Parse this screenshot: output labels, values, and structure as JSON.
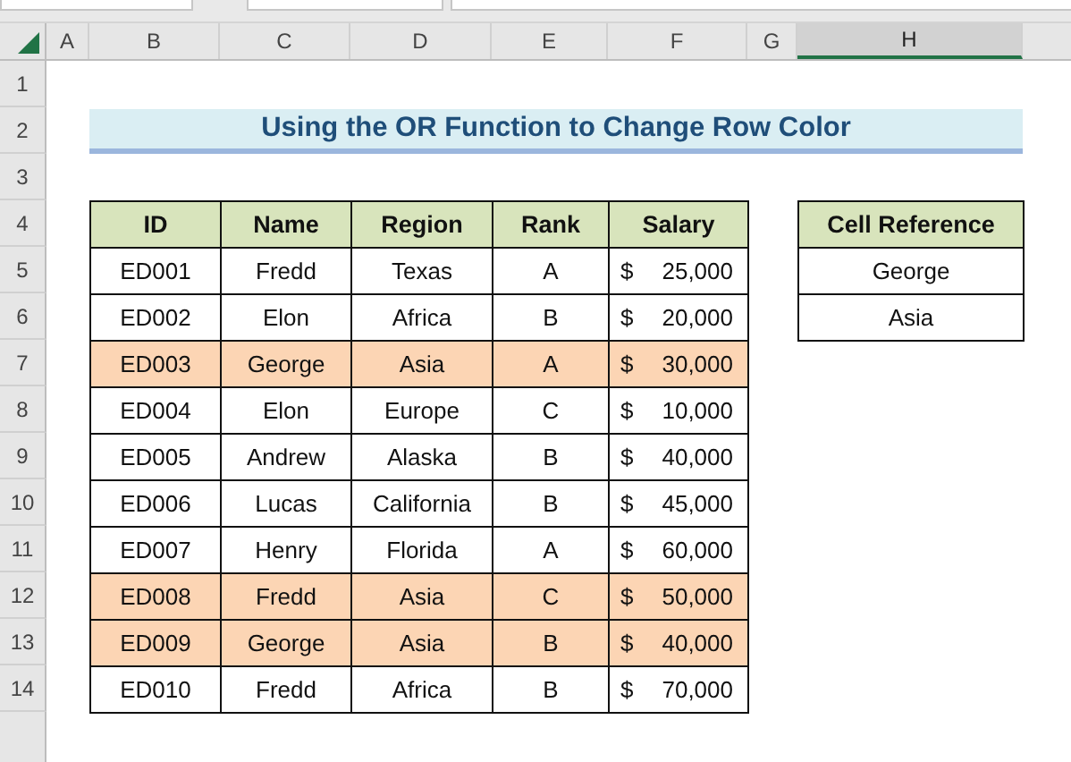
{
  "column_headers": [
    {
      "label": "A",
      "selected": false
    },
    {
      "label": "B",
      "selected": false
    },
    {
      "label": "C",
      "selected": false
    },
    {
      "label": "D",
      "selected": false
    },
    {
      "label": "E",
      "selected": false
    },
    {
      "label": "F",
      "selected": false
    },
    {
      "label": "G",
      "selected": false
    },
    {
      "label": "H",
      "selected": true
    }
  ],
  "row_headers": [
    "1",
    "2",
    "3",
    "4",
    "5",
    "6",
    "7",
    "8",
    "9",
    "10",
    "11",
    "12",
    "13",
    "14"
  ],
  "title": "Using the OR Function to Change Row Color",
  "table": {
    "columns": [
      "ID",
      "Name",
      "Region",
      "Rank",
      "Salary"
    ],
    "rows": [
      {
        "id": "ED001",
        "name": "Fredd",
        "region": "Texas",
        "rank": "A",
        "currency": "$",
        "salary": "25,000",
        "highlighted": false
      },
      {
        "id": "ED002",
        "name": "Elon",
        "region": "Africa",
        "rank": "B",
        "currency": "$",
        "salary": "20,000",
        "highlighted": false
      },
      {
        "id": "ED003",
        "name": "George",
        "region": "Asia",
        "rank": "A",
        "currency": "$",
        "salary": "30,000",
        "highlighted": true
      },
      {
        "id": "ED004",
        "name": "Elon",
        "region": "Europe",
        "rank": "C",
        "currency": "$",
        "salary": "10,000",
        "highlighted": false
      },
      {
        "id": "ED005",
        "name": "Andrew",
        "region": "Alaska",
        "rank": "B",
        "currency": "$",
        "salary": "40,000",
        "highlighted": false
      },
      {
        "id": "ED006",
        "name": "Lucas",
        "region": "California",
        "rank": "B",
        "currency": "$",
        "salary": "45,000",
        "highlighted": false
      },
      {
        "id": "ED007",
        "name": "Henry",
        "region": "Florida",
        "rank": "A",
        "currency": "$",
        "salary": "60,000",
        "highlighted": false
      },
      {
        "id": "ED008",
        "name": "Fredd",
        "region": "Asia",
        "rank": "C",
        "currency": "$",
        "salary": "50,000",
        "highlighted": true
      },
      {
        "id": "ED009",
        "name": "George",
        "region": "Asia",
        "rank": "B",
        "currency": "$",
        "salary": "40,000",
        "highlighted": true
      },
      {
        "id": "ED010",
        "name": "Fredd",
        "region": "Africa",
        "rank": "B",
        "currency": "$",
        "salary": "70,000",
        "highlighted": false
      }
    ]
  },
  "cell_reference": {
    "header": "Cell Reference",
    "values": [
      "George",
      "Asia"
    ]
  }
}
